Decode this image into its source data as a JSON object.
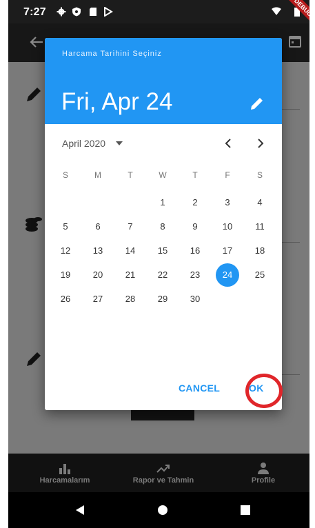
{
  "status_bar": {
    "time": "7:27"
  },
  "debug_banner": "DEBUG",
  "app_bar": {
    "title": ""
  },
  "dialog": {
    "help_text": "Harcama Tarihini Seçiniz",
    "selected_date": "Fri, Apr 24",
    "month_label": "April 2020",
    "weekdays": [
      "S",
      "M",
      "T",
      "W",
      "T",
      "F",
      "S"
    ],
    "days": [
      "1",
      "2",
      "3",
      "4",
      "5",
      "6",
      "7",
      "8",
      "9",
      "10",
      "11",
      "12",
      "13",
      "14",
      "15",
      "16",
      "17",
      "18",
      "19",
      "20",
      "21",
      "22",
      "23",
      "24",
      "25",
      "26",
      "27",
      "28",
      "29",
      "30"
    ],
    "selected_day": "24",
    "cancel_label": "CANCEL",
    "ok_label": "OK"
  },
  "bottom_nav": {
    "items": [
      {
        "label": "Harcamalarım",
        "icon": "bar-chart-icon"
      },
      {
        "label": "Rapor ve Tahmin",
        "icon": "trending-up-icon"
      },
      {
        "label": "Profile",
        "icon": "person-icon"
      }
    ]
  },
  "colors": {
    "accent": "#2196f3",
    "highlight_ring": "#e0262a",
    "debug_banner": "#b71c1c"
  }
}
